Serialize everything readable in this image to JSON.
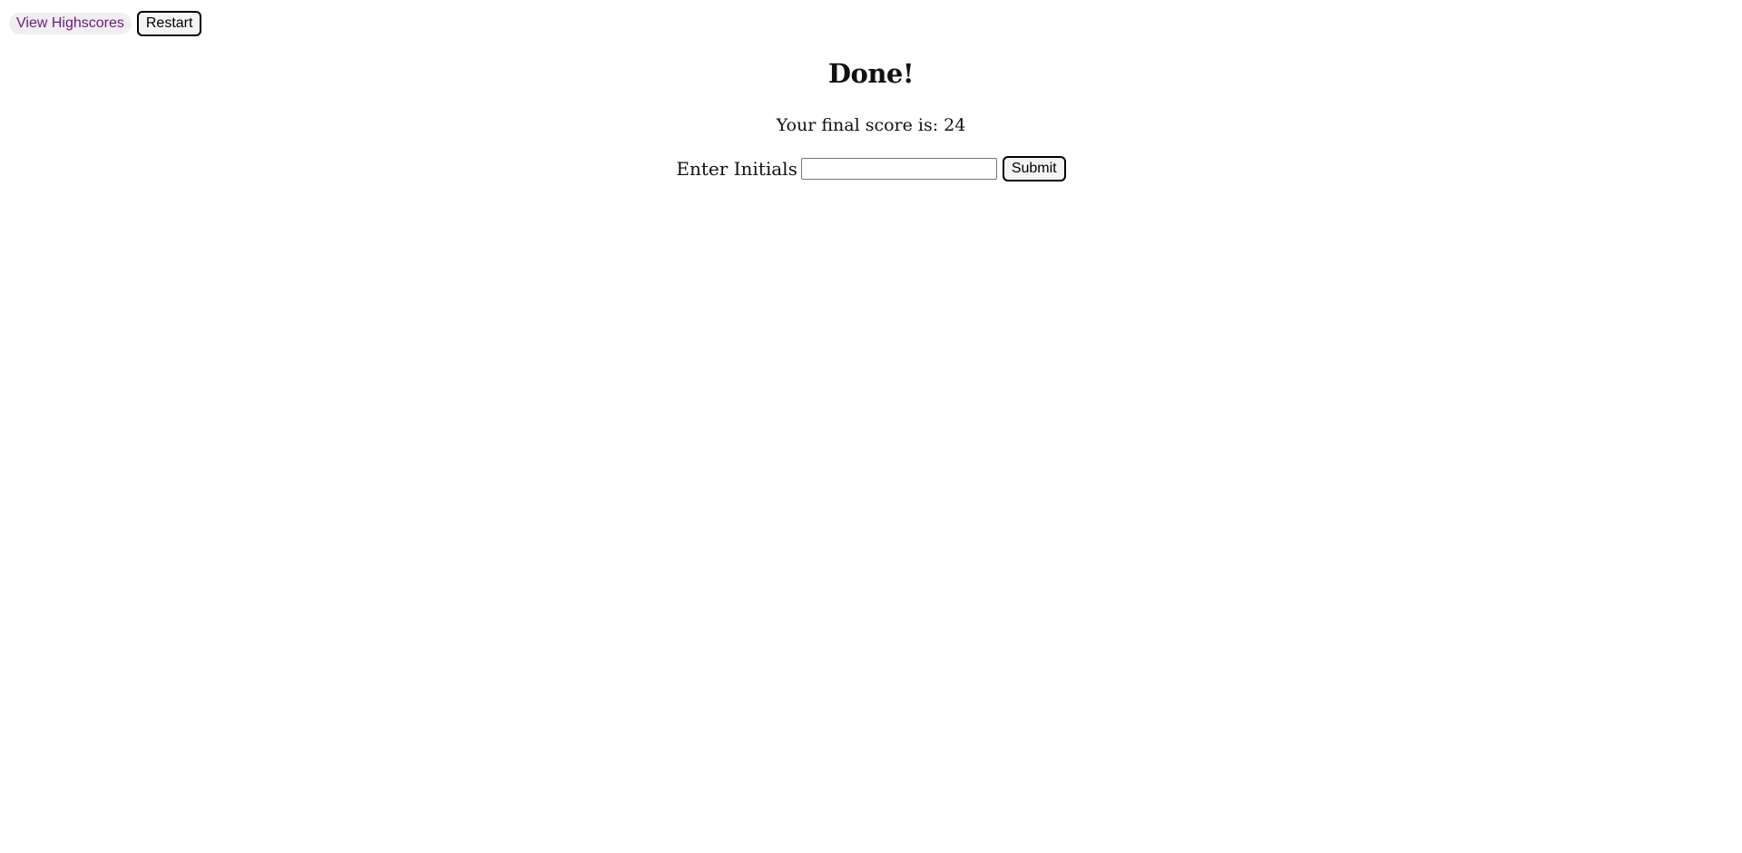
{
  "nav": {
    "highscores_label": "View Highscores",
    "restart_label": "Restart"
  },
  "result": {
    "title": "Done!",
    "score_text": "Your final score is: 24",
    "score": 24
  },
  "form": {
    "initials_label": "Enter Initials",
    "initials_value": "",
    "submit_label": "Submit"
  },
  "colors": {
    "link": "#6a1b7a",
    "link_bg": "#f1eef2",
    "button_border": "#000000"
  }
}
